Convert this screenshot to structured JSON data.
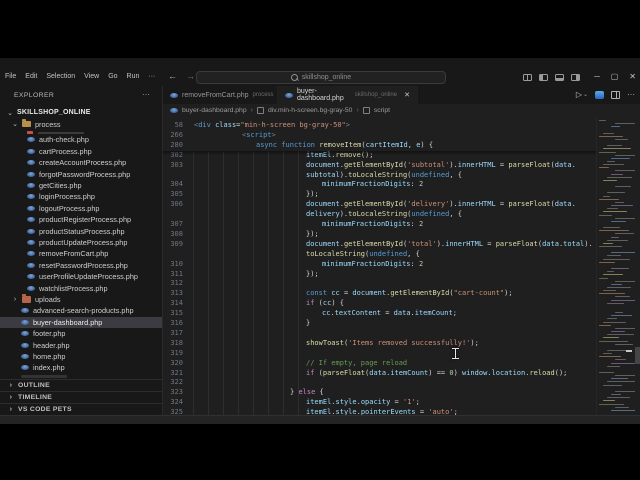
{
  "colors": {
    "editor_bg": "#1f1f1f",
    "chrome_bg": "#181818",
    "selection_bg": "#3b3b41",
    "php_icon_blue": "#4a6fa5",
    "folder_tan": "#b98f4e",
    "folder_red": "#b5654a"
  },
  "titlebar": {
    "menus": [
      "File",
      "Edit",
      "Selection",
      "View",
      "Go",
      "Run"
    ],
    "menu_more": "···",
    "nav_back": "←",
    "nav_forward": "→",
    "search_text": "skillshop_online",
    "window_controls": {
      "minimize": "─",
      "maximize": "▢",
      "close": "✕"
    }
  },
  "explorer": {
    "header": "EXPLORER",
    "header_more": "···",
    "root": "SKILLSHOP_ONLINE",
    "root_caret": "⌄",
    "folder_caret_open": "⌄",
    "folder_caret_closed": "›",
    "tree": [
      {
        "label": "process",
        "type": "folder-open",
        "level": 1
      },
      {
        "label": "",
        "type": "partial-red",
        "level": 2
      },
      {
        "label": "auth-check.php",
        "type": "php",
        "level": 2
      },
      {
        "label": "cartProcess.php",
        "type": "php",
        "level": 2
      },
      {
        "label": "createAccountProcess.php",
        "type": "php",
        "level": 2
      },
      {
        "label": "forgotPasswordProcess.php",
        "type": "php",
        "level": 2
      },
      {
        "label": "getCities.php",
        "type": "php",
        "level": 2
      },
      {
        "label": "loginProcess.php",
        "type": "php",
        "level": 2
      },
      {
        "label": "logoutProcess.php",
        "type": "php",
        "level": 2
      },
      {
        "label": "productRegisterProcess.php",
        "type": "php",
        "level": 2
      },
      {
        "label": "productStatusProcess.php",
        "type": "php",
        "level": 2
      },
      {
        "label": "productUpdateProcess.php",
        "type": "php",
        "level": 2
      },
      {
        "label": "removeFromCart.php",
        "type": "php",
        "level": 2
      },
      {
        "label": "resetPasswordProcess.php",
        "type": "php",
        "level": 2
      },
      {
        "label": "userProfileUpdateProcess.php",
        "type": "php",
        "level": 2
      },
      {
        "label": "watchlistProcess.php",
        "type": "php",
        "level": 2
      },
      {
        "label": "uploads",
        "type": "folder-closed",
        "level": 1
      },
      {
        "label": "advanced-search-products.php",
        "type": "php",
        "level": 1
      },
      {
        "label": "buyer-dashboard.php",
        "type": "php",
        "level": 1,
        "selected": true
      },
      {
        "label": "footer.php",
        "type": "php",
        "level": 1
      },
      {
        "label": "header.php",
        "type": "php",
        "level": 1
      },
      {
        "label": "home.php",
        "type": "php",
        "level": 1
      },
      {
        "label": "index.php",
        "type": "php",
        "level": 1
      },
      {
        "label": "",
        "type": "partial-dim",
        "level": 1
      }
    ],
    "sections": [
      "OUTLINE",
      "TIMELINE",
      "VS CODE PETS"
    ]
  },
  "tabs": [
    {
      "title": "removeFromCart.php",
      "hint": "process",
      "active": false,
      "close": ""
    },
    {
      "title": "buyer-dashboard.php",
      "hint": "skillshop_online",
      "active": true,
      "close": "✕"
    }
  ],
  "editor_actions": {
    "run": "▷",
    "run_caret": "⌄",
    "more": "···"
  },
  "breadcrumb": {
    "file": "buyer-dashboard.php",
    "separator": "›",
    "items": [
      "div.min-h-screen.bg-gray-50",
      "script"
    ]
  },
  "editor": {
    "rows": [
      {
        "n": "58",
        "ind": 2,
        "tok": [
          [
            "brk",
            "<"
          ],
          [
            "tag",
            "div"
          ],
          [
            "def",
            " "
          ],
          [
            "attr",
            "class"
          ],
          [
            "def",
            "="
          ],
          [
            "str",
            "\"min-h-screen bg-gray-50\""
          ],
          [
            "brk",
            ">"
          ]
        ]
      },
      {
        "n": "266",
        "ind": 50,
        "tok": [
          [
            "brk",
            "<"
          ],
          [
            "tag",
            "script"
          ],
          [
            "brk",
            ">"
          ]
        ]
      },
      {
        "n": "280",
        "ind": 64,
        "tok": [
          [
            "kw",
            "async"
          ],
          [
            "def",
            " "
          ],
          [
            "kw",
            "function"
          ],
          [
            "def",
            " "
          ],
          [
            "fn",
            "removeItem"
          ],
          [
            "def",
            "("
          ],
          [
            "var",
            "cartItemId"
          ],
          [
            "def",
            ", "
          ],
          [
            "var",
            "e"
          ],
          [
            "def",
            ") {"
          ]
        ]
      },
      {
        "n": "302",
        "ind": 114,
        "tok": [
          [
            "var",
            "itemEl"
          ],
          [
            "def",
            "."
          ],
          [
            "fn",
            "remove"
          ],
          [
            "def",
            "();"
          ]
        ]
      },
      {
        "n": "303",
        "ind": 114,
        "tok": [
          [
            "var",
            "document"
          ],
          [
            "def",
            "."
          ],
          [
            "fn",
            "getElementById"
          ],
          [
            "def",
            "("
          ],
          [
            "str",
            "'subtotal'"
          ],
          [
            "def",
            ")."
          ],
          [
            "var",
            "innerHTML"
          ],
          [
            "def",
            " = "
          ],
          [
            "fn",
            "parseFloat"
          ],
          [
            "def",
            "("
          ],
          [
            "var",
            "data"
          ],
          [
            "def",
            "."
          ]
        ]
      },
      {
        "n": "",
        "ind": 114,
        "tok": [
          [
            "var",
            "subtotal"
          ],
          [
            "def",
            ")."
          ],
          [
            "fn",
            "toLocaleString"
          ],
          [
            "def",
            "("
          ],
          [
            "kw",
            "undefined"
          ],
          [
            "def",
            ", {"
          ]
        ]
      },
      {
        "n": "304",
        "ind": 130,
        "tok": [
          [
            "var",
            "minimumFractionDigits"
          ],
          [
            "def",
            ": "
          ],
          [
            "num",
            "2"
          ]
        ]
      },
      {
        "n": "305",
        "ind": 114,
        "tok": [
          [
            "def",
            "});"
          ]
        ]
      },
      {
        "n": "306",
        "ind": 114,
        "tok": [
          [
            "var",
            "document"
          ],
          [
            "def",
            "."
          ],
          [
            "fn",
            "getElementById"
          ],
          [
            "def",
            "("
          ],
          [
            "str",
            "'delivery'"
          ],
          [
            "def",
            ")."
          ],
          [
            "var",
            "innerHTML"
          ],
          [
            "def",
            " = "
          ],
          [
            "fn",
            "parseFloat"
          ],
          [
            "def",
            "("
          ],
          [
            "var",
            "data"
          ],
          [
            "def",
            "."
          ]
        ]
      },
      {
        "n": "",
        "ind": 114,
        "tok": [
          [
            "var",
            "delivery"
          ],
          [
            "def",
            ")."
          ],
          [
            "fn",
            "toLocaleString"
          ],
          [
            "def",
            "("
          ],
          [
            "kw",
            "undefined"
          ],
          [
            "def",
            ", {"
          ]
        ]
      },
      {
        "n": "307",
        "ind": 130,
        "tok": [
          [
            "var",
            "minimumFractionDigits"
          ],
          [
            "def",
            ": "
          ],
          [
            "num",
            "2"
          ]
        ]
      },
      {
        "n": "308",
        "ind": 114,
        "tok": [
          [
            "def",
            "});"
          ]
        ]
      },
      {
        "n": "309",
        "ind": 114,
        "tok": [
          [
            "var",
            "document"
          ],
          [
            "def",
            "."
          ],
          [
            "fn",
            "getElementById"
          ],
          [
            "def",
            "("
          ],
          [
            "str",
            "'total'"
          ],
          [
            "def",
            ")."
          ],
          [
            "var",
            "innerHTML"
          ],
          [
            "def",
            " = "
          ],
          [
            "fn",
            "parseFloat"
          ],
          [
            "def",
            "("
          ],
          [
            "var",
            "data"
          ],
          [
            "def",
            "."
          ],
          [
            "var",
            "total"
          ],
          [
            "def",
            ")."
          ]
        ]
      },
      {
        "n": "",
        "ind": 114,
        "tok": [
          [
            "fn",
            "toLocaleString"
          ],
          [
            "def",
            "("
          ],
          [
            "kw",
            "undefined"
          ],
          [
            "def",
            ", {"
          ]
        ]
      },
      {
        "n": "310",
        "ind": 130,
        "tok": [
          [
            "var",
            "minimumFractionDigits"
          ],
          [
            "def",
            ": "
          ],
          [
            "num",
            "2"
          ]
        ]
      },
      {
        "n": "311",
        "ind": 114,
        "tok": [
          [
            "def",
            "});"
          ]
        ]
      },
      {
        "n": "312",
        "ind": 114,
        "tok": []
      },
      {
        "n": "313",
        "ind": 114,
        "tok": [
          [
            "kw",
            "const"
          ],
          [
            "def",
            " "
          ],
          [
            "var",
            "cc"
          ],
          [
            "def",
            " = "
          ],
          [
            "var",
            "document"
          ],
          [
            "def",
            "."
          ],
          [
            "fn",
            "getElementById"
          ],
          [
            "def",
            "("
          ],
          [
            "str",
            "\"cart-count\""
          ],
          [
            "def",
            ");"
          ]
        ]
      },
      {
        "n": "314",
        "ind": 114,
        "tok": [
          [
            "ctl",
            "if"
          ],
          [
            "def",
            " ("
          ],
          [
            "var",
            "cc"
          ],
          [
            "def",
            ") {"
          ]
        ]
      },
      {
        "n": "315",
        "ind": 130,
        "tok": [
          [
            "var",
            "cc"
          ],
          [
            "def",
            "."
          ],
          [
            "var",
            "textContent"
          ],
          [
            "def",
            " = "
          ],
          [
            "var",
            "data"
          ],
          [
            "def",
            "."
          ],
          [
            "var",
            "itemCount"
          ],
          [
            "def",
            ";"
          ]
        ]
      },
      {
        "n": "316",
        "ind": 114,
        "tok": [
          [
            "def",
            "}"
          ]
        ]
      },
      {
        "n": "317",
        "ind": 114,
        "tok": []
      },
      {
        "n": "318",
        "ind": 114,
        "tok": [
          [
            "fn",
            "showToast"
          ],
          [
            "def",
            "("
          ],
          [
            "str",
            "'Items removed successfully!'"
          ],
          [
            "def",
            ");"
          ]
        ]
      },
      {
        "n": "319",
        "ind": 114,
        "tok": []
      },
      {
        "n": "320",
        "ind": 114,
        "tok": [
          [
            "cmt",
            "// If empty, page reload"
          ]
        ]
      },
      {
        "n": "321",
        "ind": 114,
        "tok": [
          [
            "ctl",
            "if"
          ],
          [
            "def",
            " ("
          ],
          [
            "fn",
            "parseFloat"
          ],
          [
            "def",
            "("
          ],
          [
            "var",
            "data"
          ],
          [
            "def",
            "."
          ],
          [
            "var",
            "itemCount"
          ],
          [
            "def",
            ") == "
          ],
          [
            "num",
            "0"
          ],
          [
            "def",
            ") "
          ],
          [
            "var",
            "window"
          ],
          [
            "def",
            "."
          ],
          [
            "var",
            "location"
          ],
          [
            "def",
            "."
          ],
          [
            "fn",
            "reload"
          ],
          [
            "def",
            "();"
          ]
        ]
      },
      {
        "n": "322",
        "ind": 114,
        "tok": []
      },
      {
        "n": "323",
        "ind": 98,
        "tok": [
          [
            "def",
            "} "
          ],
          [
            "ctl",
            "else"
          ],
          [
            "def",
            " {"
          ]
        ]
      },
      {
        "n": "324",
        "ind": 114,
        "tok": [
          [
            "var",
            "itemEl"
          ],
          [
            "def",
            "."
          ],
          [
            "var",
            "style"
          ],
          [
            "def",
            "."
          ],
          [
            "var",
            "opacity"
          ],
          [
            "def",
            " = "
          ],
          [
            "str",
            "'1'"
          ],
          [
            "def",
            ";"
          ]
        ]
      },
      {
        "n": "325",
        "ind": 114,
        "tok": [
          [
            "var",
            "itemEl"
          ],
          [
            "def",
            "."
          ],
          [
            "var",
            "style"
          ],
          [
            "def",
            "."
          ],
          [
            "var",
            "pointerEvents"
          ],
          [
            "def",
            " = "
          ],
          [
            "str",
            "'auto'"
          ],
          [
            "def",
            ";"
          ]
        ]
      }
    ]
  }
}
